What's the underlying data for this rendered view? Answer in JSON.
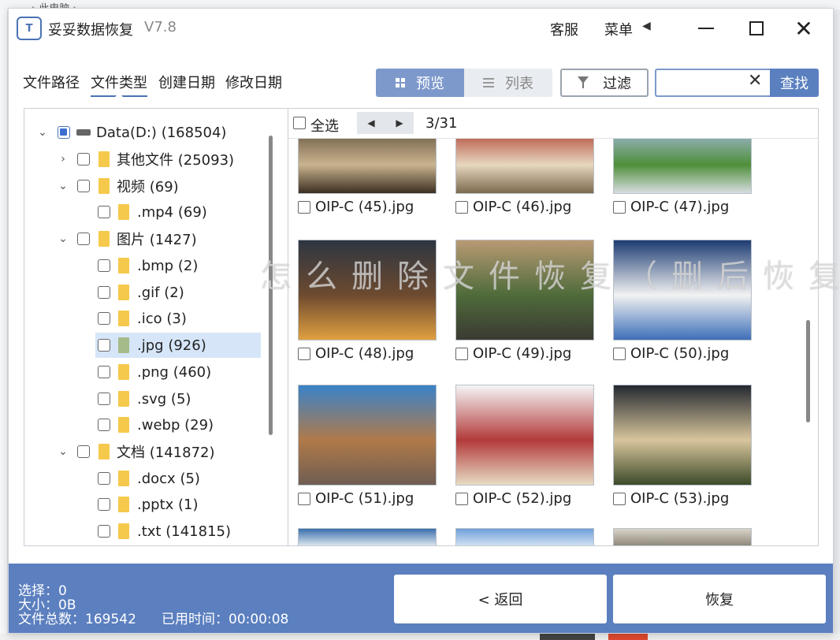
{
  "background": {
    "top_text": "› 此电脑 ›"
  },
  "app": {
    "title": "妥妥数据恢复",
    "version": "V7.8",
    "logo_text": "T",
    "service_label": "客服",
    "menu_label": "菜单",
    "menu_arrow": "◀",
    "close_glyph": "✕"
  },
  "category_tabs": [
    {
      "label": "文件路径"
    },
    {
      "label": "文件类型"
    },
    {
      "label": "创建日期"
    },
    {
      "label": "修改日期"
    }
  ],
  "view": {
    "preview_label": "预览",
    "list_label": "列表"
  },
  "filter": {
    "label": "过滤"
  },
  "search": {
    "placeholder": "",
    "value": "",
    "clear_glyph": "✕",
    "button_label": "查找"
  },
  "tree": {
    "rows": [
      {
        "expander": "⌄",
        "label": "Data(D:)",
        "count": "(168504)"
      },
      {
        "expander": "›",
        "label": "其他文件",
        "count": "(25093)"
      },
      {
        "expander": "⌄",
        "label": "视频",
        "count": "(69)"
      },
      {
        "expander": "",
        "label": ".mp4",
        "count": "(69)"
      },
      {
        "expander": "⌄",
        "label": "图片",
        "count": "(1427)"
      },
      {
        "expander": "",
        "label": ".bmp",
        "count": "(2)"
      },
      {
        "expander": "",
        "label": ".gif",
        "count": "(2)"
      },
      {
        "expander": "",
        "label": ".ico",
        "count": "(3)"
      },
      {
        "expander": "",
        "label": ".jpg",
        "count": "(926)"
      },
      {
        "expander": "",
        "label": ".png",
        "count": "(460)"
      },
      {
        "expander": "",
        "label": ".svg",
        "count": "(5)"
      },
      {
        "expander": "",
        "label": ".webp",
        "count": "(29)"
      },
      {
        "expander": "⌄",
        "label": "文档",
        "count": "(141872)"
      },
      {
        "expander": "",
        "label": ".docx",
        "count": "(5)"
      },
      {
        "expander": "",
        "label": ".pptx",
        "count": "(1)"
      },
      {
        "expander": "",
        "label": ".txt",
        "count": "(141815)"
      }
    ]
  },
  "grid": {
    "select_all_label": "全选",
    "prev_glyph": "◀",
    "next_glyph": "▶",
    "page_info": "3/31",
    "thumbs": [
      {
        "name": "OIP-C (45).jpg",
        "colors": [
          "#6b5a44",
          "#c9b48f",
          "#3d2f22"
        ]
      },
      {
        "name": "OIP-C (46).jpg",
        "colors": [
          "#b14a3a",
          "#e7d7bf",
          "#7c6a4e"
        ]
      },
      {
        "name": "OIP-C (47).jpg",
        "colors": [
          "#9fb6cf",
          "#4f8f3a",
          "#d8dde2"
        ]
      },
      {
        "name": "OIP-C (48).jpg",
        "colors": [
          "#2e3641",
          "#6d4a2f",
          "#e0a040"
        ]
      },
      {
        "name": "OIP-C (49).jpg",
        "colors": [
          "#b89a74",
          "#4f6b3a",
          "#3a3a32"
        ]
      },
      {
        "name": "OIP-C (50).jpg",
        "colors": [
          "#1d3c73",
          "#f2f2f2",
          "#3e6fb8"
        ]
      },
      {
        "name": "OIP-C (51).jpg",
        "colors": [
          "#3a82c8",
          "#b07a4a",
          "#6f5d52"
        ]
      },
      {
        "name": "OIP-C (52).jpg",
        "colors": [
          "#f5f5f5",
          "#b33a3a",
          "#e7dcc5"
        ]
      },
      {
        "name": "OIP-C (53).jpg",
        "colors": [
          "#242930",
          "#d8c59c",
          "#3c4a2a"
        ]
      },
      {
        "name": "",
        "colors": [
          "#3a6fae",
          "#d9e3ec",
          "#ffffff"
        ]
      },
      {
        "name": "",
        "colors": [
          "#6ea0da",
          "#cfe0f2",
          "#9dbde3"
        ]
      },
      {
        "name": "",
        "colors": [
          "#d9d4c8",
          "#8f8a7c",
          "#ebe6da"
        ]
      }
    ]
  },
  "footer": {
    "selected_label": "选择：0",
    "size_label": "大小：0B",
    "total_label": "文件总数：169542",
    "elapsed_label": "已用时间：00:00:08",
    "back_label": "< 返回",
    "recover_label": "恢复"
  },
  "watermark": "怎么删除文件恢复（删后恢复）"
}
